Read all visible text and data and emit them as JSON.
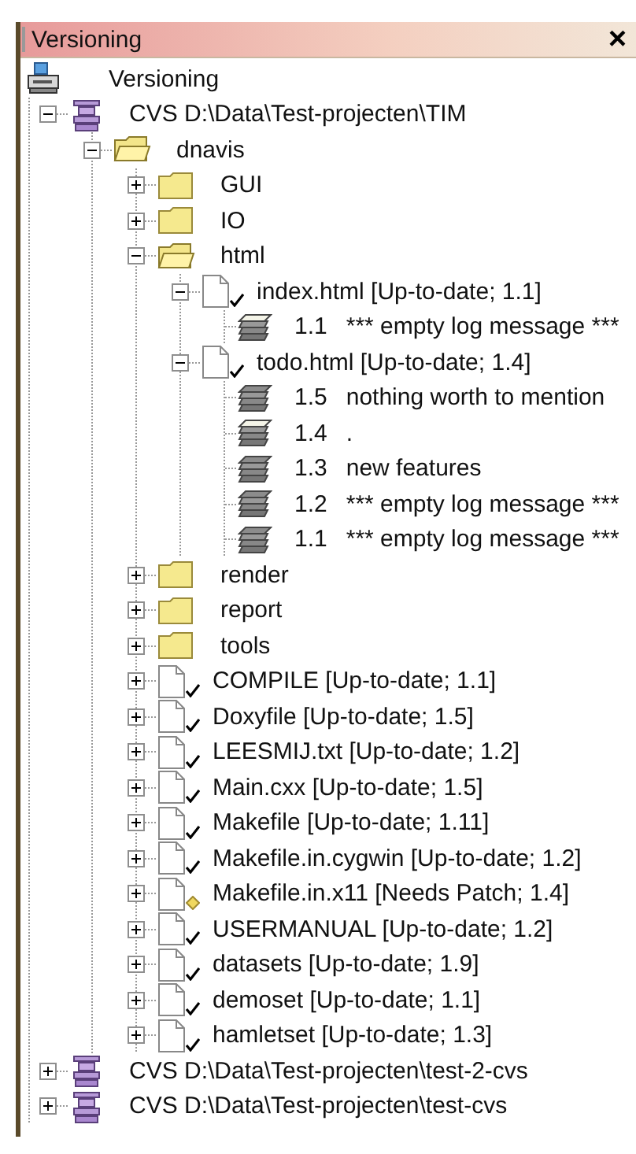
{
  "panel": {
    "title": "Versioning",
    "close": "×"
  },
  "tree": {
    "kind": "root",
    "label": "Versioning",
    "children": [
      {
        "kind": "repo",
        "label": "CVS D:\\Data\\Test-projecten\\TIM",
        "expanded": true,
        "children": [
          {
            "kind": "folder",
            "label": "dnavis",
            "expanded": true,
            "children": [
              {
                "kind": "folder",
                "label": "GUI",
                "expanded": false
              },
              {
                "kind": "folder",
                "label": "IO",
                "expanded": false
              },
              {
                "kind": "folder",
                "label": "html",
                "expanded": true,
                "children": [
                  {
                    "kind": "file",
                    "label": "index.html [Up-to-date; 1.1]",
                    "needs_patch": false,
                    "expanded": true,
                    "children": [
                      {
                        "kind": "revision",
                        "revision": "1.1",
                        "message": "*** empty log message ***",
                        "current": true
                      }
                    ]
                  },
                  {
                    "kind": "file",
                    "label": "todo.html [Up-to-date; 1.4]",
                    "needs_patch": false,
                    "expanded": true,
                    "children": [
                      {
                        "kind": "revision",
                        "revision": "1.5",
                        "message": "nothing worth to mention",
                        "current": false
                      },
                      {
                        "kind": "revision",
                        "revision": "1.4",
                        "message": ".",
                        "current": true
                      },
                      {
                        "kind": "revision",
                        "revision": "1.3",
                        "message": "new features",
                        "current": false
                      },
                      {
                        "kind": "revision",
                        "revision": "1.2",
                        "message": "*** empty log message ***",
                        "current": false
                      },
                      {
                        "kind": "revision",
                        "revision": "1.1",
                        "message": "*** empty log message ***",
                        "current": false
                      }
                    ]
                  }
                ]
              },
              {
                "kind": "folder",
                "label": "render",
                "expanded": false
              },
              {
                "kind": "folder",
                "label": "report",
                "expanded": false
              },
              {
                "kind": "folder",
                "label": "tools",
                "expanded": false
              },
              {
                "kind": "file",
                "label": "COMPILE [Up-to-date; 1.1]",
                "needs_patch": false,
                "expanded": false
              },
              {
                "kind": "file",
                "label": "Doxyfile [Up-to-date; 1.5]",
                "needs_patch": false,
                "expanded": false
              },
              {
                "kind": "file",
                "label": "LEESMIJ.txt [Up-to-date; 1.2]",
                "needs_patch": false,
                "expanded": false
              },
              {
                "kind": "file",
                "label": "Main.cxx [Up-to-date; 1.5]",
                "needs_patch": false,
                "expanded": false
              },
              {
                "kind": "file",
                "label": "Makefile [Up-to-date; 1.11]",
                "needs_patch": false,
                "expanded": false
              },
              {
                "kind": "file",
                "label": "Makefile.in.cygwin [Up-to-date; 1.2]",
                "needs_patch": false,
                "expanded": false
              },
              {
                "kind": "file",
                "label": "Makefile.in.x11 [Needs Patch; 1.4]",
                "needs_patch": true,
                "expanded": false
              },
              {
                "kind": "file",
                "label": "USERMANUAL [Up-to-date; 1.2]",
                "needs_patch": false,
                "expanded": false
              },
              {
                "kind": "file",
                "label": "datasets [Up-to-date; 1.9]",
                "needs_patch": false,
                "expanded": false
              },
              {
                "kind": "file",
                "label": "demoset [Up-to-date; 1.1]",
                "needs_patch": false,
                "expanded": false
              },
              {
                "kind": "file",
                "label": "hamletset [Up-to-date; 1.3]",
                "needs_patch": false,
                "expanded": false
              }
            ]
          }
        ]
      },
      {
        "kind": "repo",
        "label": "CVS D:\\Data\\Test-projecten\\test-2-cvs",
        "expanded": false
      },
      {
        "kind": "repo",
        "label": "CVS D:\\Data\\Test-projecten\\test-cvs",
        "expanded": false
      }
    ]
  }
}
